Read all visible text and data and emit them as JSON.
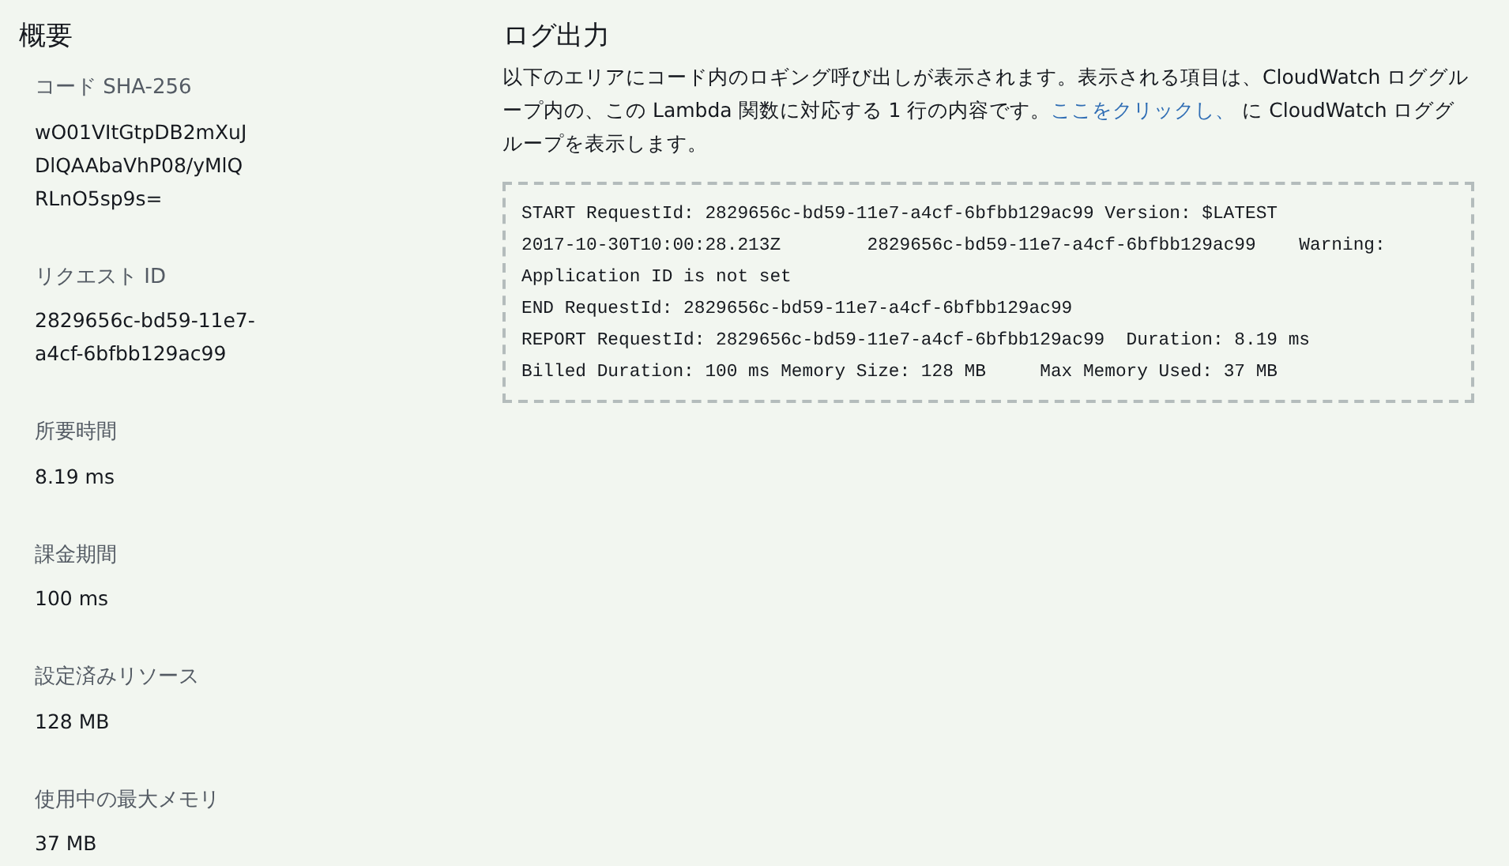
{
  "summary": {
    "title": "概要",
    "fields": [
      {
        "label": "コード SHA-256",
        "value_lines": [
          "wO01VItGtpDB2mXuJ",
          "DlQAAbaVhP08/yMlQ",
          "RLnO5sp9s="
        ]
      },
      {
        "label": "リクエスト ID",
        "value_lines": [
          "2829656c-bd59-11e7-",
          "a4cf-6bfbb129ac99"
        ]
      },
      {
        "label": "所要時間",
        "value_lines": [
          "8.19 ms"
        ]
      },
      {
        "label": "課金期間",
        "value_lines": [
          "100 ms"
        ]
      },
      {
        "label": "設定済みリソース",
        "value_lines": [
          "128 MB"
        ]
      },
      {
        "label": "使用中の最大メモリ",
        "value_lines": [
          "37 MB"
        ]
      }
    ]
  },
  "log_output": {
    "title": "ログ出力",
    "description": {
      "text_before": "以下のエリアにコード内のロギング呼び出しが表示されます。表示される項目は、CloudWatch ロググループ内の、この Lambda 関数に対応する 1 行の内容です。",
      "link": "ここをクリックし、",
      "text_after": " に CloudWatch ロググループを表示します。"
    },
    "lines": [
      "START RequestId: 2829656c-bd59-11e7-a4cf-6bfbb129ac99 Version: $LATEST",
      "2017-10-30T10:00:28.213Z\t2829656c-bd59-11e7-a4cf-6bfbb129ac99\tWarning:",
      "Application ID is not set",
      "END RequestId: 2829656c-bd59-11e7-a4cf-6bfbb129ac99",
      "REPORT RequestId: 2829656c-bd59-11e7-a4cf-6bfbb129ac99\tDuration: 8.19 ms",
      "Billed Duration: 100 ms\tMemory Size: 128 MB\tMax Memory Used: 37 MB"
    ]
  }
}
